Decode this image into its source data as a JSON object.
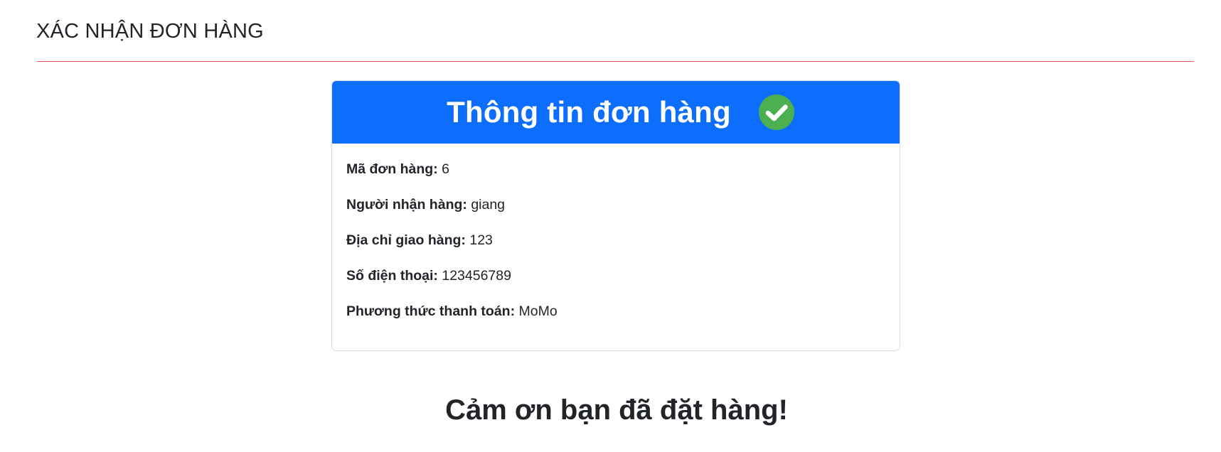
{
  "page": {
    "title": "XÁC NHẬN ĐƠN HÀNG",
    "accent_rule_color": "#e2525a"
  },
  "card": {
    "header_title": "Thông tin đơn hàng",
    "header_bg": "#0d6efd",
    "status_icon": "check-circle-icon",
    "status_icon_color": "#4caf50",
    "fields": [
      {
        "label": "Mã đơn hàng:",
        "value": "6"
      },
      {
        "label": "Người nhận hàng:",
        "value": "giang"
      },
      {
        "label": "Địa chỉ giao hàng:",
        "value": "123"
      },
      {
        "label": "Số điện thoại:",
        "value": "123456789"
      },
      {
        "label": "Phương thức thanh toán:",
        "value": "MoMo"
      }
    ]
  },
  "footer": {
    "thanks_message": "Cảm ơn bạn đã đặt hàng!"
  }
}
